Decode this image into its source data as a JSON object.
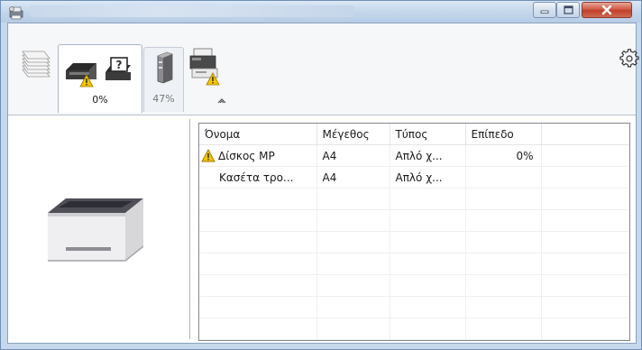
{
  "window": {
    "title": "",
    "minimize_icon": "minimize-icon",
    "maximize_icon": "maximize-icon",
    "close_icon": "close-icon"
  },
  "toolbar": {
    "tabs": [
      {
        "name": "paper-stack-tab",
        "label": "",
        "icon": "paper-stack-icon"
      },
      {
        "name": "toner-tab",
        "label": "0%",
        "icon": "toner-warning-icon"
      },
      {
        "name": "waste-toner-tab",
        "label": "47%",
        "icon": "waste-toner-icon"
      },
      {
        "name": "device-tab",
        "label": "",
        "icon": "printer-warning-icon"
      }
    ],
    "collapse_icon": "collapse-chevron-icon",
    "settings_icon": "gear-icon"
  },
  "table": {
    "columns": [
      "Όνομα",
      "Μέγεθος",
      "Τύπος",
      "Επίπεδο"
    ],
    "rows": [
      {
        "name": "Δίσκος MP",
        "size": "A4",
        "type": "Απλό χ...",
        "level": "0%",
        "warning": true
      },
      {
        "name": "Κασέτα τρο...",
        "size": "A4",
        "type": "Απλό χ...",
        "level": "",
        "warning": false
      }
    ],
    "empty_rows": 7
  },
  "colors": {
    "warning": "#f5c400",
    "title_bar": "#c2d5ea",
    "close_button": "#c0402b"
  }
}
